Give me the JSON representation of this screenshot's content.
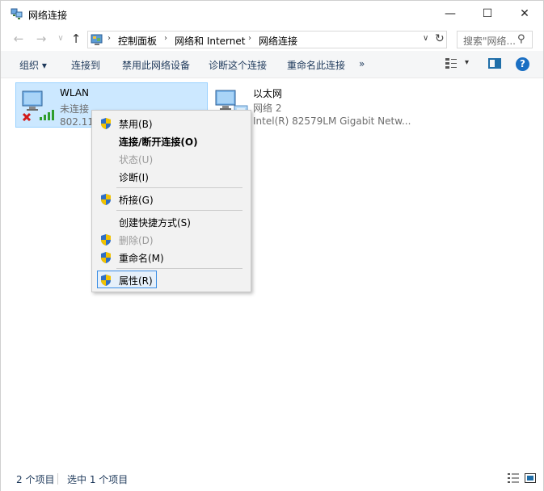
{
  "window": {
    "title": "网络连接",
    "controls": {
      "minimize": "—",
      "maximize": "☐",
      "close": "✕"
    }
  },
  "nav": {
    "back": "←",
    "forward": "→",
    "recent": "∨",
    "up": "↑"
  },
  "address": {
    "crumbs": [
      "控制面板",
      "网络和 Internet",
      "网络连接"
    ],
    "separator": "›",
    "dropdown": "∨",
    "refresh": "↻"
  },
  "search": {
    "placeholder": "搜索\"网络...",
    "icon": "search-icon"
  },
  "toolbar": {
    "organize": "组织 ▾",
    "connect_to": "连接到",
    "disable_device": "禁用此网络设备",
    "diagnose": "诊断这个连接",
    "rename": "重命名此连接",
    "more": "»",
    "view_dropdown": "▾",
    "help": "?"
  },
  "connections": [
    {
      "name": "WLAN",
      "status": "未连接",
      "device": "802.11ac",
      "selected": true,
      "icon": "wireless-network-disconnected-icon"
    },
    {
      "name": "以太网",
      "status": "网络 2",
      "device": "Intel(R) 82579LM Gigabit Netw...",
      "selected": false,
      "icon": "ethernet-network-icon"
    }
  ],
  "context_menu": {
    "items": [
      {
        "label": "禁用(B)",
        "shield": true,
        "disabled": false,
        "bold": false
      },
      {
        "label": "连接/断开连接(O)",
        "shield": false,
        "disabled": false,
        "bold": true
      },
      {
        "label": "状态(U)",
        "shield": false,
        "disabled": true,
        "bold": false
      },
      {
        "label": "诊断(I)",
        "shield": false,
        "disabled": false,
        "bold": false
      },
      {
        "label": "桥接(G)",
        "shield": true,
        "disabled": false,
        "bold": false
      },
      {
        "label": "创建快捷方式(S)",
        "shield": false,
        "disabled": false,
        "bold": false
      },
      {
        "label": "删除(D)",
        "shield": true,
        "disabled": true,
        "bold": false
      },
      {
        "label": "重命名(M)",
        "shield": true,
        "disabled": false,
        "bold": false
      },
      {
        "label": "属性(R)",
        "shield": true,
        "disabled": false,
        "bold": false,
        "focused": true
      }
    ]
  },
  "status": {
    "item_count": "2 个项目",
    "selected_count": "选中 1 个项目"
  },
  "colors": {
    "selection_bg": "#cce8ff",
    "selection_border": "#99d1ff",
    "accent": "#1a6fc3",
    "shield_blue": "#2f6fc6",
    "shield_yellow": "#f2c200"
  }
}
